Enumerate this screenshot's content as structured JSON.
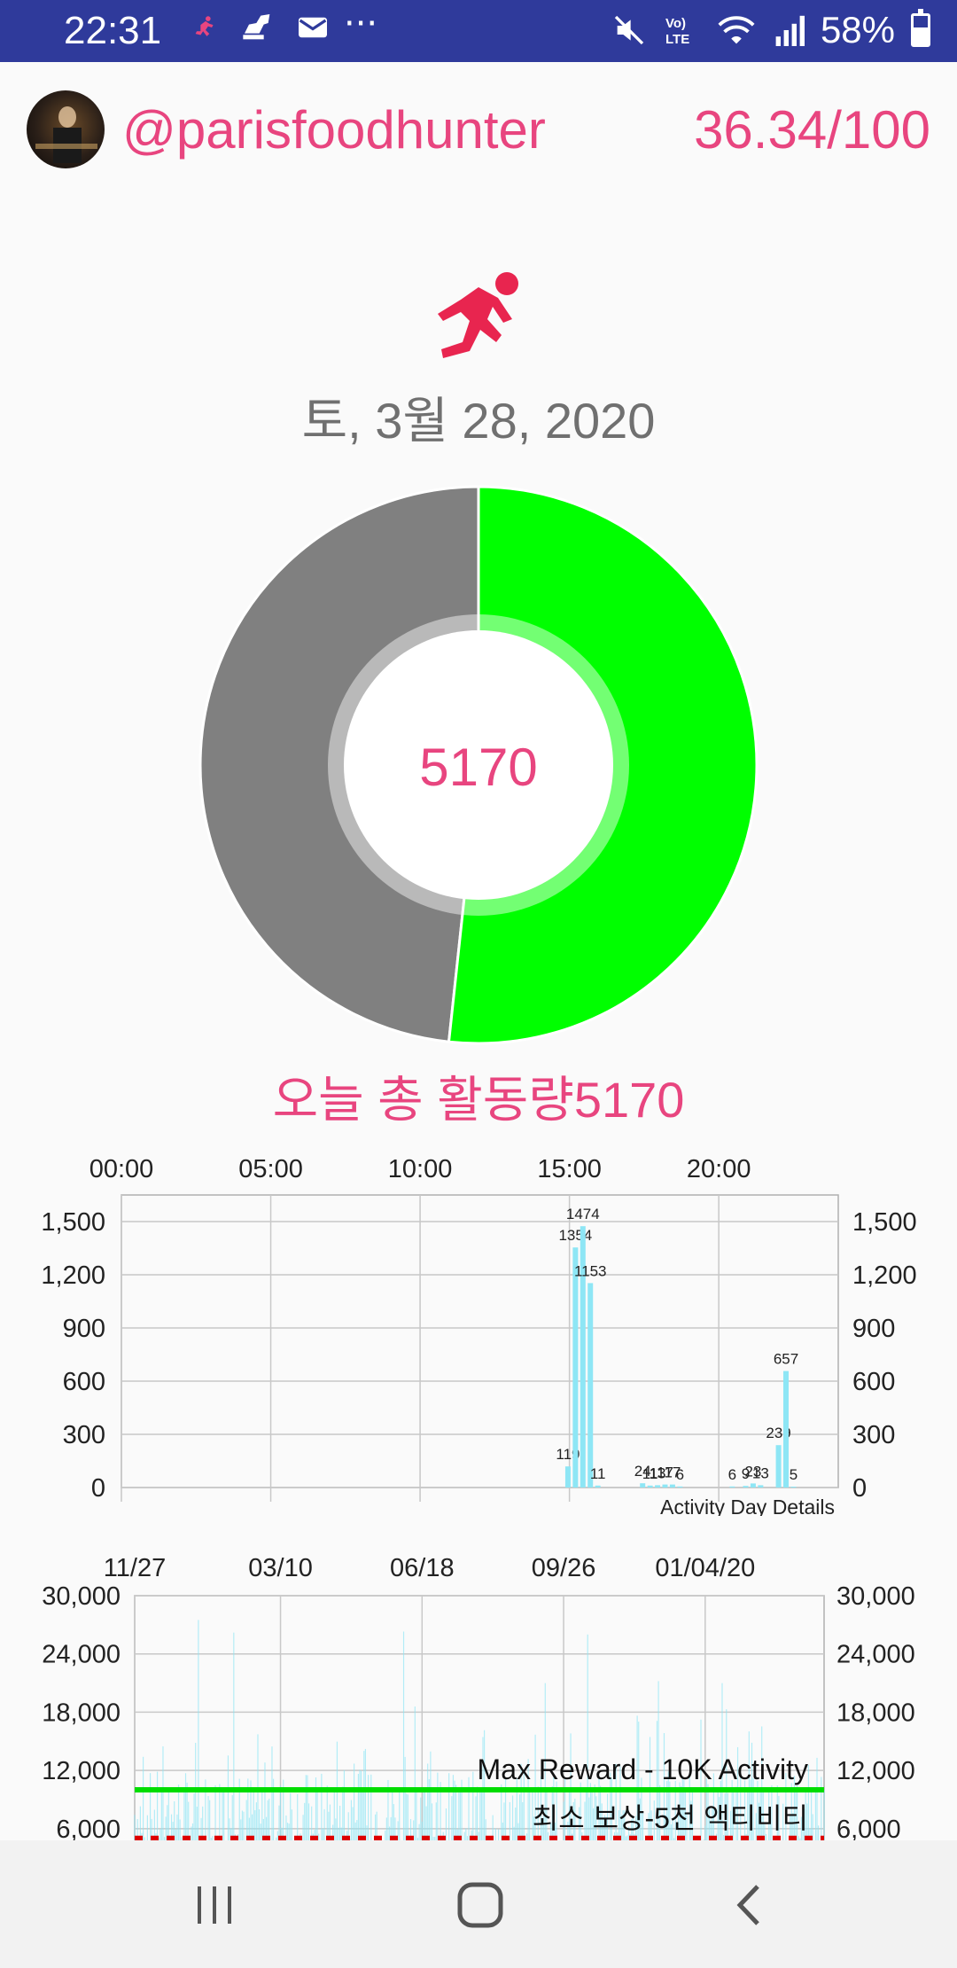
{
  "status_bar": {
    "time": "22:31",
    "battery": "58%",
    "battery_level": 0.58,
    "icons": [
      "runner-icon",
      "broom-icon",
      "mail-icon",
      "more-dots-icon",
      "mute-icon",
      "volte-icon",
      "wifi-icon",
      "signal-icon",
      "battery-icon"
    ],
    "dots": "···"
  },
  "header": {
    "username": "@parisfoodhunter",
    "score": "36.34/100"
  },
  "colors": {
    "accent": "#e8457f",
    "progress": "#00ff00",
    "remaining": "#808080",
    "bars": "#8ee6f5",
    "max_line": "#00dd00",
    "min_line": "#dd0000"
  },
  "date": "토, 3월 28, 2020",
  "donut": {
    "center_value": "5170",
    "progress_fraction": 0.517
  },
  "total_label": "오늘 총 활동량5170",
  "chart_data": [
    {
      "type": "bar",
      "title": "",
      "xlabel": "",
      "ylabel": "",
      "x_ticks": [
        "00:00",
        "05:00",
        "10:00",
        "15:00",
        "20:00"
      ],
      "x_tick_hours": [
        0,
        5,
        10,
        15,
        20
      ],
      "y_ticks": [
        "0",
        "300",
        "600",
        "900",
        "1,200",
        "1,500"
      ],
      "ylim": [
        0,
        1650
      ],
      "xlim_hours": [
        0,
        24
      ],
      "description_label": "Activity Day Details",
      "grid": true,
      "bars": [
        {
          "hour": 14.95,
          "value": 119,
          "label": "119"
        },
        {
          "hour": 15.2,
          "value": 1354,
          "label": "1354"
        },
        {
          "hour": 15.45,
          "value": 1474,
          "label": "1474"
        },
        {
          "hour": 15.7,
          "value": 1153,
          "label": "1153"
        },
        {
          "hour": 15.95,
          "value": 11,
          "label": "11"
        },
        {
          "hour": 17.45,
          "value": 24,
          "label": "24"
        },
        {
          "hour": 17.7,
          "value": 11,
          "label": "11"
        },
        {
          "hour": 17.95,
          "value": 13,
          "label": "13"
        },
        {
          "hour": 18.2,
          "value": 17,
          "label": "17"
        },
        {
          "hour": 18.45,
          "value": 17,
          "label": "17"
        },
        {
          "hour": 18.7,
          "value": 6,
          "label": "6"
        },
        {
          "hour": 20.45,
          "value": 6,
          "label": "6"
        },
        {
          "hour": 20.9,
          "value": 9,
          "label": "9"
        },
        {
          "hour": 21.15,
          "value": 23,
          "label": "23"
        },
        {
          "hour": 21.4,
          "value": 13,
          "label": "13"
        },
        {
          "hour": 22.0,
          "value": 239,
          "label": "239"
        },
        {
          "hour": 22.25,
          "value": 657,
          "label": "657"
        },
        {
          "hour": 22.5,
          "value": 5,
          "label": "5"
        }
      ]
    },
    {
      "type": "bar",
      "title": "",
      "xlabel": "",
      "ylabel": "",
      "x_ticks": [
        "11/27",
        "03/10",
        "06/18",
        "09/26",
        "01/04/20"
      ],
      "y_ticks": [
        "6,000",
        "12,000",
        "18,000",
        "24,000",
        "30,000"
      ],
      "ylim": [
        4800,
        30000
      ],
      "grid": true,
      "days": 488,
      "tick_days": [
        0,
        103,
        203,
        303,
        403
      ],
      "limit_lines": [
        {
          "value": 10000,
          "label": "Max Reward - 10K Activity",
          "style": "solid",
          "color": "#00dd00"
        },
        {
          "value": 5000,
          "label": "최소 보상-5천 액티비티",
          "style": "dashed",
          "color": "#dd0000"
        }
      ],
      "peaks": [
        {
          "day": 45,
          "value": 27500
        },
        {
          "day": 70,
          "value": 26200
        },
        {
          "day": 190,
          "value": 26300
        },
        {
          "day": 290,
          "value": 21000
        },
        {
          "day": 320,
          "value": 26000
        },
        {
          "day": 370,
          "value": 21200
        },
        {
          "day": 415,
          "value": 21000
        }
      ]
    }
  ],
  "nav": {
    "icons": [
      "recent-apps-icon",
      "home-icon",
      "back-icon"
    ]
  }
}
